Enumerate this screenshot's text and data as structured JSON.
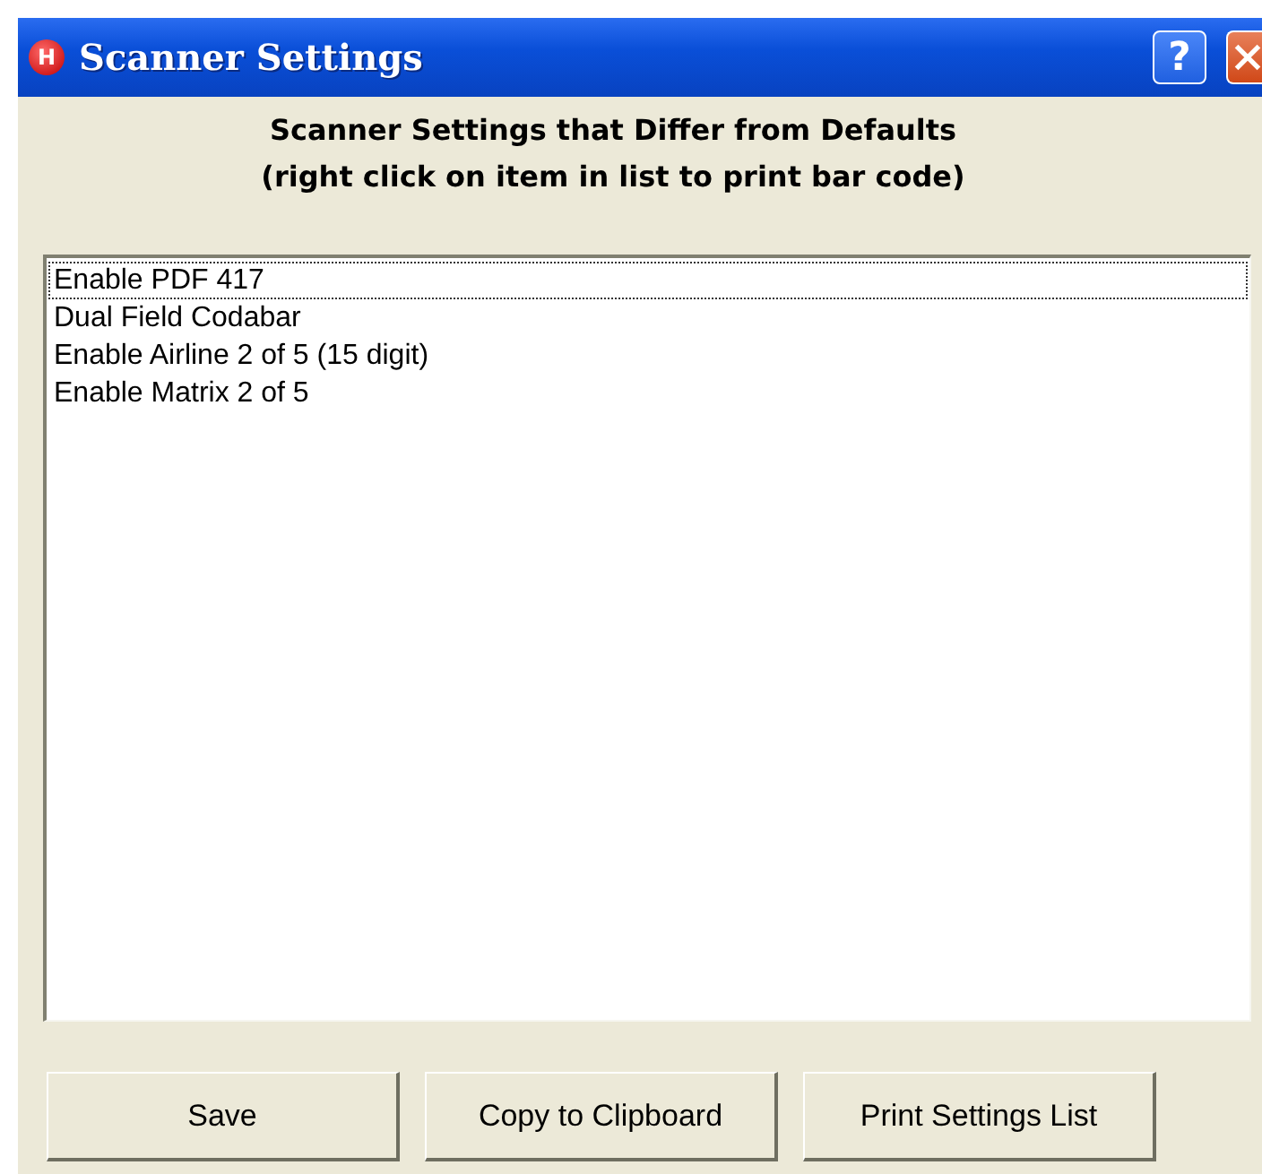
{
  "window": {
    "title": "Scanner Settings",
    "icon_letter": "H",
    "help_button": "?"
  },
  "heading": [
    "Scanner Settings that Differ from Defaults",
    "(right click on item in list to print bar code)"
  ],
  "list": {
    "items": [
      {
        "label": "Enable PDF 417",
        "focused": true
      },
      {
        "label": "Dual Field Codabar",
        "focused": false
      },
      {
        "label": "Enable Airline 2 of 5 (15 digit)",
        "focused": false
      },
      {
        "label": "Enable Matrix 2 of 5",
        "focused": false
      }
    ]
  },
  "buttons": [
    "Save",
    "Copy to Clipboard",
    "Print Settings List"
  ]
}
